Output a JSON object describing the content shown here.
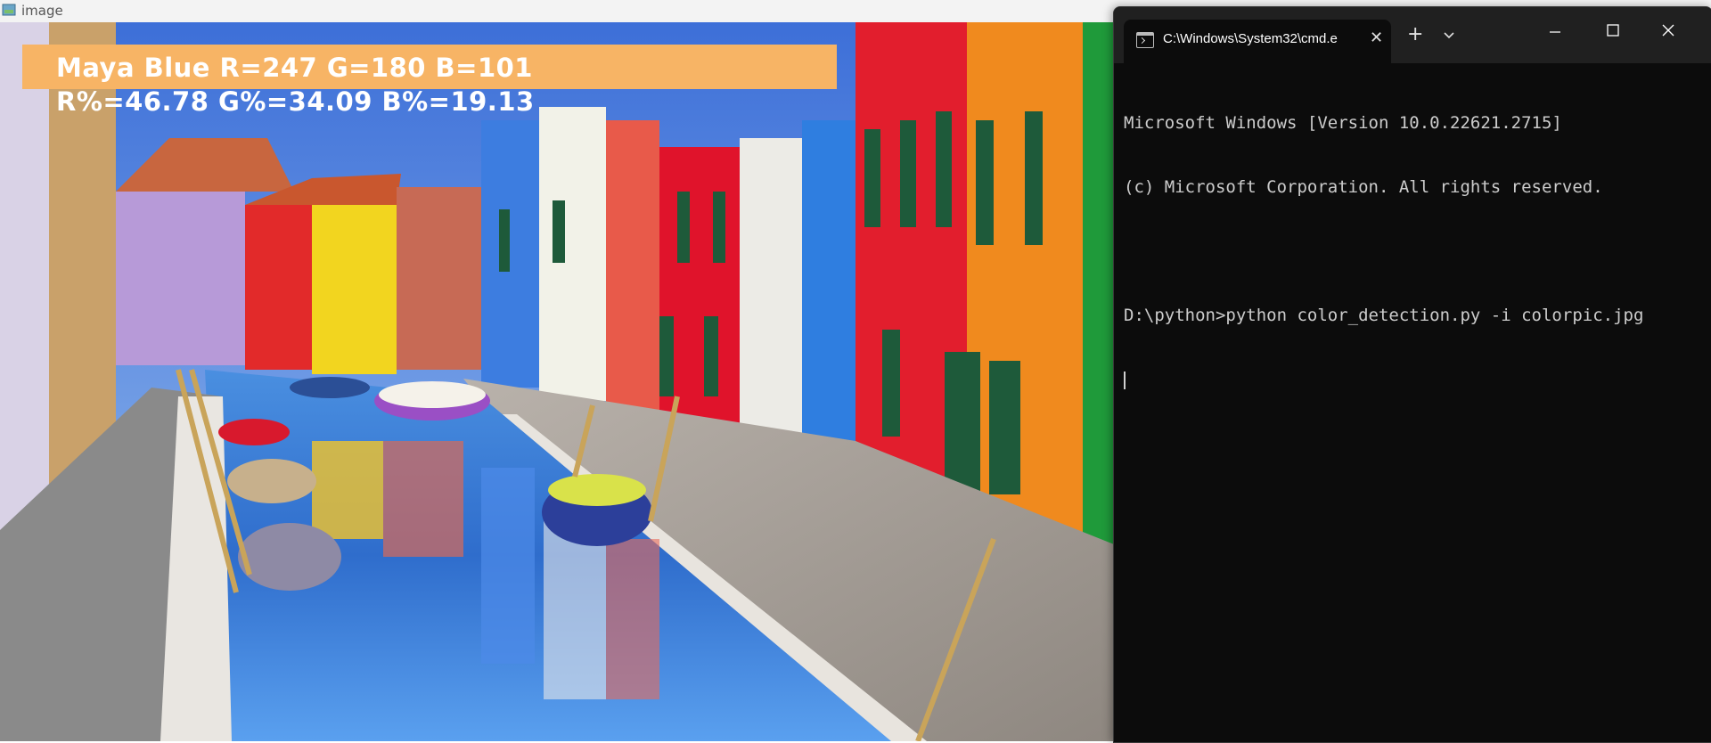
{
  "image_window": {
    "title": "image",
    "detected_color": {
      "name_and_rgb": "Maya Blue R=247 G=180 B=101",
      "percentages": "R%=46.78 G%=34.09 B%=19.13",
      "banner_color": "#f7b465"
    }
  },
  "terminal": {
    "tab_title": "C:\\Windows\\System32\\cmd.e",
    "new_tab_label": "+",
    "lines": [
      "Microsoft Windows [Version 10.0.22621.2715]",
      "(c) Microsoft Corporation. All rights reserved.",
      "",
      "D:\\python>python color_detection.py -i colorpic.jpg"
    ],
    "background": "#0c0c0c",
    "foreground": "#cccccc"
  },
  "icons": {
    "image_app": "image-app-icon",
    "terminal_tab": "terminal-icon",
    "tab_close": "close-icon",
    "new_tab": "plus-icon",
    "dropdown": "chevron-down-icon",
    "minimize": "minimize-icon",
    "maximize": "maximize-icon",
    "close": "close-icon"
  }
}
